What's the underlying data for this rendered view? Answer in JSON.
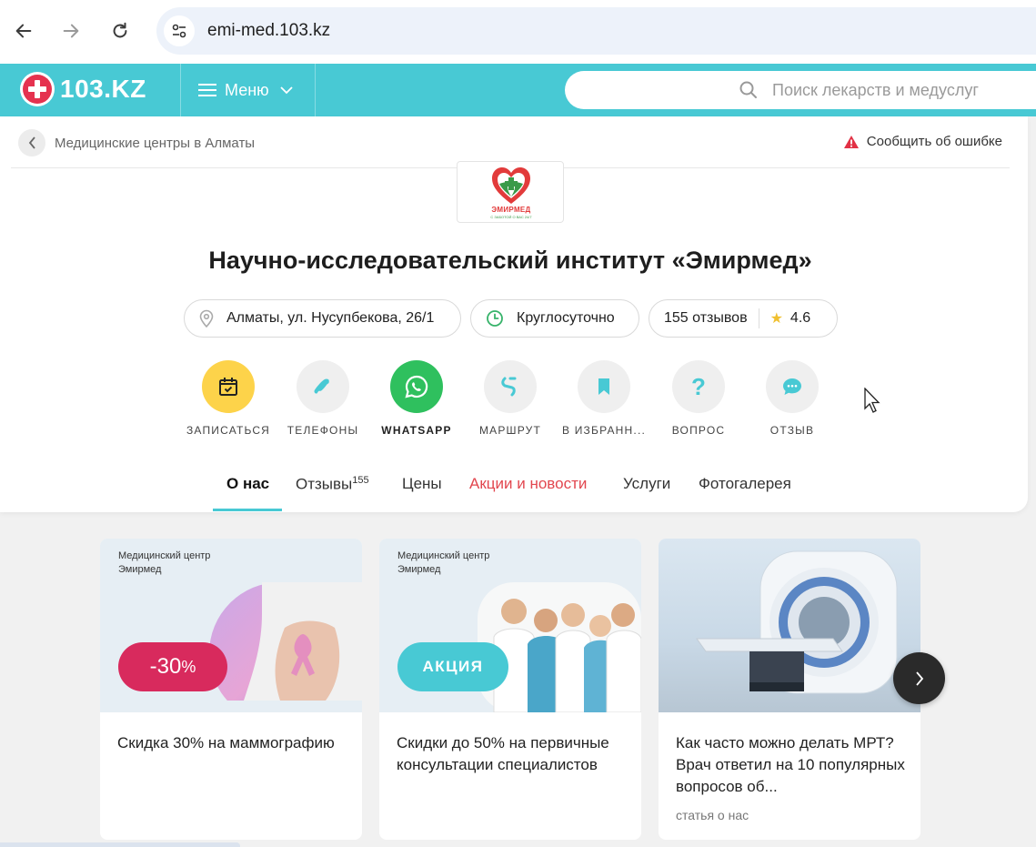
{
  "browser": {
    "url": "emi-med.103.kz"
  },
  "header": {
    "logo_text": "103.KZ",
    "menu_label": "Меню",
    "search_placeholder": "Поиск лекарств и медуслуг",
    "accent_color": "#48c9d4"
  },
  "breadcrumb": {
    "label": "Медицинские центры в Алматы"
  },
  "report_error": "Сообщить об ошибке",
  "clinic": {
    "logo_brand": "ЭМИРМЕД",
    "logo_tagline": "С ЗАБОТОЙ О ВАС 24/7",
    "title": "Научно-исследовательский институт «Эмирмед»",
    "address": "Алматы, ул. Нусупбекова, 26/1",
    "hours": "Круглосуточно",
    "reviews": "155 отзывов",
    "rating": "4.6"
  },
  "actions": [
    {
      "label": "ЗАПИСАТЬСЯ",
      "icon": "calendar-check-icon"
    },
    {
      "label": "ТЕЛЕФОНЫ",
      "icon": "phone-icon"
    },
    {
      "label": "WHATSAPP",
      "icon": "whatsapp-icon"
    },
    {
      "label": "МАРШРУТ",
      "icon": "route-icon"
    },
    {
      "label": "В ИЗБРАНН...",
      "icon": "bookmark-icon"
    },
    {
      "label": "ВОПРОС",
      "icon": "question-icon"
    },
    {
      "label": "ОТЗЫВ",
      "icon": "chat-bubble-icon"
    }
  ],
  "tabs": [
    {
      "label": "О нас"
    },
    {
      "label": "Отзывы",
      "count": "155"
    },
    {
      "label": "Цены"
    },
    {
      "label": "Акции и новости"
    },
    {
      "label": "Услуги"
    },
    {
      "label": "Фотогалерея"
    }
  ],
  "news": [
    {
      "image_caption_1": "Медицинский центр",
      "image_caption_2": "Эмирмед",
      "badge_main": "-30",
      "badge_suffix": "%",
      "title": "Скидка 30% на маммографию",
      "meta": ""
    },
    {
      "image_caption_1": "Медицинский центр",
      "image_caption_2": "Эмирмед",
      "badge_main": "АКЦИЯ",
      "title": "Скидки до 50% на первичные консультации специалистов",
      "meta": ""
    },
    {
      "title": "Как часто можно делать МРТ? Врач ответил на 10 популярных вопросов об...",
      "meta": "статья о нас"
    }
  ]
}
